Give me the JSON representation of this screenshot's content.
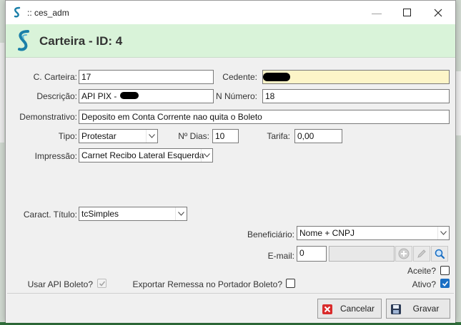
{
  "window": {
    "title": ":: ces_adm",
    "minimize": "—",
    "maximize": "□",
    "close": "✕"
  },
  "header": {
    "title": "Carteira - ID:  4"
  },
  "form": {
    "c_carteira": {
      "label": "C. Carteira:",
      "value": "17"
    },
    "cedente": {
      "label": "Cedente:",
      "value": ""
    },
    "descricao": {
      "label": "Descrição:",
      "value": "API PIX -"
    },
    "n_numero": {
      "label": "N Número:",
      "value": "18"
    },
    "demonstrativo": {
      "label": "Demonstrativo:",
      "value": "Deposito em Conta Corrente nao quita o Boleto"
    },
    "tipo": {
      "label": "Tipo:",
      "value": "Protestar"
    },
    "n_dias": {
      "label": "Nº Dias:",
      "value": "10"
    },
    "tarifa": {
      "label": "Tarifa:",
      "value": "0,00"
    },
    "impressao": {
      "label": "Impressão:",
      "value": "Carnet Recibo Lateral Esquerda"
    },
    "caract_titulo": {
      "label": "Caract. Título:",
      "value": "tcSimples"
    },
    "beneficiario": {
      "label": "Beneficiário:",
      "value": "Nome + CNPJ"
    },
    "email": {
      "label": "E-mail:",
      "value": "0",
      "value2": ""
    },
    "aceite": {
      "label": "Aceite?",
      "checked": false
    },
    "usar_api": {
      "label": "Usar API Boleto?",
      "checked": true,
      "disabled": true
    },
    "exportar": {
      "label": "Exportar Remessa no Portador Boleto?",
      "checked": false
    },
    "ativo": {
      "label": "Ativo?",
      "checked": true
    }
  },
  "buttons": {
    "cancelar": "Cancelar",
    "gravar": "Gravar"
  },
  "colors": {
    "header_bg": "#d9f3d9",
    "cedente_bg": "#fdf5c8",
    "accent": "#1a6fc4",
    "logo": "#1a7fa8"
  }
}
